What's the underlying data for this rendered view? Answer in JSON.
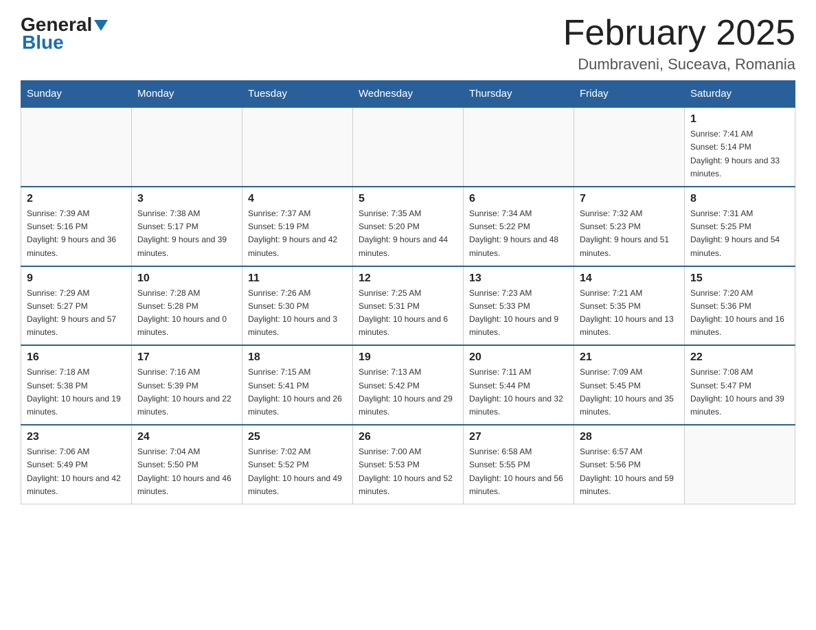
{
  "header": {
    "logo_line1": "General",
    "logo_line2": "Blue",
    "title": "February 2025",
    "location": "Dumbraveni, Suceava, Romania"
  },
  "calendar": {
    "days_of_week": [
      "Sunday",
      "Monday",
      "Tuesday",
      "Wednesday",
      "Thursday",
      "Friday",
      "Saturday"
    ],
    "weeks": [
      [
        {
          "day": "",
          "info": ""
        },
        {
          "day": "",
          "info": ""
        },
        {
          "day": "",
          "info": ""
        },
        {
          "day": "",
          "info": ""
        },
        {
          "day": "",
          "info": ""
        },
        {
          "day": "",
          "info": ""
        },
        {
          "day": "1",
          "info": "Sunrise: 7:41 AM\nSunset: 5:14 PM\nDaylight: 9 hours and 33 minutes."
        }
      ],
      [
        {
          "day": "2",
          "info": "Sunrise: 7:39 AM\nSunset: 5:16 PM\nDaylight: 9 hours and 36 minutes."
        },
        {
          "day": "3",
          "info": "Sunrise: 7:38 AM\nSunset: 5:17 PM\nDaylight: 9 hours and 39 minutes."
        },
        {
          "day": "4",
          "info": "Sunrise: 7:37 AM\nSunset: 5:19 PM\nDaylight: 9 hours and 42 minutes."
        },
        {
          "day": "5",
          "info": "Sunrise: 7:35 AM\nSunset: 5:20 PM\nDaylight: 9 hours and 44 minutes."
        },
        {
          "day": "6",
          "info": "Sunrise: 7:34 AM\nSunset: 5:22 PM\nDaylight: 9 hours and 48 minutes."
        },
        {
          "day": "7",
          "info": "Sunrise: 7:32 AM\nSunset: 5:23 PM\nDaylight: 9 hours and 51 minutes."
        },
        {
          "day": "8",
          "info": "Sunrise: 7:31 AM\nSunset: 5:25 PM\nDaylight: 9 hours and 54 minutes."
        }
      ],
      [
        {
          "day": "9",
          "info": "Sunrise: 7:29 AM\nSunset: 5:27 PM\nDaylight: 9 hours and 57 minutes."
        },
        {
          "day": "10",
          "info": "Sunrise: 7:28 AM\nSunset: 5:28 PM\nDaylight: 10 hours and 0 minutes."
        },
        {
          "day": "11",
          "info": "Sunrise: 7:26 AM\nSunset: 5:30 PM\nDaylight: 10 hours and 3 minutes."
        },
        {
          "day": "12",
          "info": "Sunrise: 7:25 AM\nSunset: 5:31 PM\nDaylight: 10 hours and 6 minutes."
        },
        {
          "day": "13",
          "info": "Sunrise: 7:23 AM\nSunset: 5:33 PM\nDaylight: 10 hours and 9 minutes."
        },
        {
          "day": "14",
          "info": "Sunrise: 7:21 AM\nSunset: 5:35 PM\nDaylight: 10 hours and 13 minutes."
        },
        {
          "day": "15",
          "info": "Sunrise: 7:20 AM\nSunset: 5:36 PM\nDaylight: 10 hours and 16 minutes."
        }
      ],
      [
        {
          "day": "16",
          "info": "Sunrise: 7:18 AM\nSunset: 5:38 PM\nDaylight: 10 hours and 19 minutes."
        },
        {
          "day": "17",
          "info": "Sunrise: 7:16 AM\nSunset: 5:39 PM\nDaylight: 10 hours and 22 minutes."
        },
        {
          "day": "18",
          "info": "Sunrise: 7:15 AM\nSunset: 5:41 PM\nDaylight: 10 hours and 26 minutes."
        },
        {
          "day": "19",
          "info": "Sunrise: 7:13 AM\nSunset: 5:42 PM\nDaylight: 10 hours and 29 minutes."
        },
        {
          "day": "20",
          "info": "Sunrise: 7:11 AM\nSunset: 5:44 PM\nDaylight: 10 hours and 32 minutes."
        },
        {
          "day": "21",
          "info": "Sunrise: 7:09 AM\nSunset: 5:45 PM\nDaylight: 10 hours and 35 minutes."
        },
        {
          "day": "22",
          "info": "Sunrise: 7:08 AM\nSunset: 5:47 PM\nDaylight: 10 hours and 39 minutes."
        }
      ],
      [
        {
          "day": "23",
          "info": "Sunrise: 7:06 AM\nSunset: 5:49 PM\nDaylight: 10 hours and 42 minutes."
        },
        {
          "day": "24",
          "info": "Sunrise: 7:04 AM\nSunset: 5:50 PM\nDaylight: 10 hours and 46 minutes."
        },
        {
          "day": "25",
          "info": "Sunrise: 7:02 AM\nSunset: 5:52 PM\nDaylight: 10 hours and 49 minutes."
        },
        {
          "day": "26",
          "info": "Sunrise: 7:00 AM\nSunset: 5:53 PM\nDaylight: 10 hours and 52 minutes."
        },
        {
          "day": "27",
          "info": "Sunrise: 6:58 AM\nSunset: 5:55 PM\nDaylight: 10 hours and 56 minutes."
        },
        {
          "day": "28",
          "info": "Sunrise: 6:57 AM\nSunset: 5:56 PM\nDaylight: 10 hours and 59 minutes."
        },
        {
          "day": "",
          "info": ""
        }
      ]
    ]
  }
}
